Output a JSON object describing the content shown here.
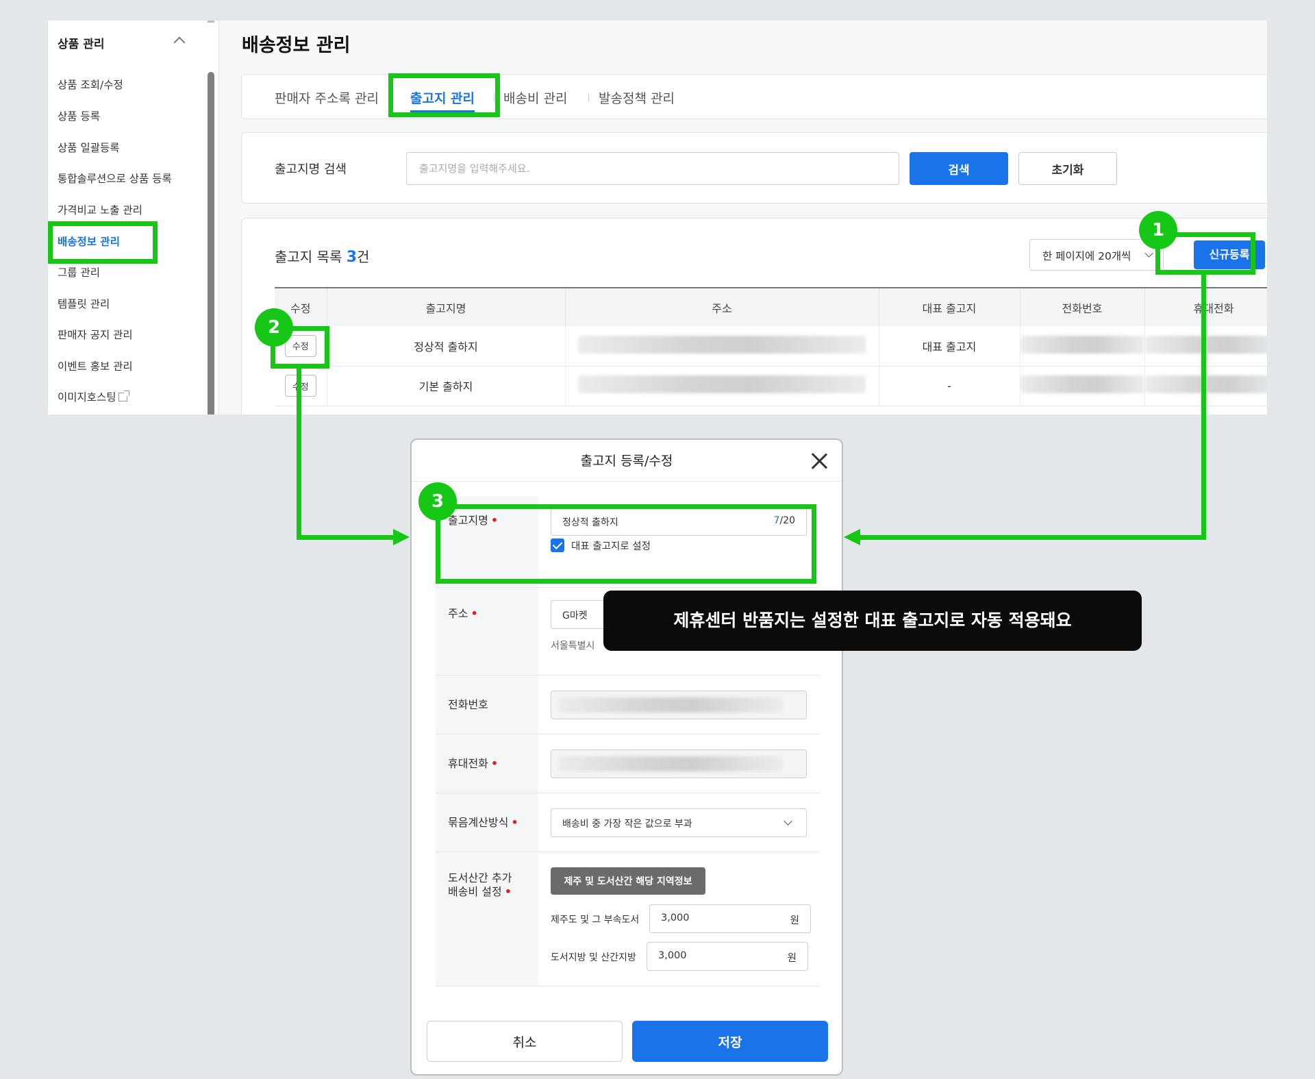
{
  "sidebar": {
    "section_title": "상품 관리",
    "items": [
      {
        "label": "상품 조회/수정"
      },
      {
        "label": "상품 등록"
      },
      {
        "label": "상품 일괄등록"
      },
      {
        "label": "통합솔루션으로 상품 등록"
      },
      {
        "label": "가격비교 노출 관리"
      },
      {
        "label": "배송정보 관리",
        "active": true
      },
      {
        "label": "그룹 관리"
      },
      {
        "label": "템플릿 관리"
      },
      {
        "label": "판매자 공지 관리"
      },
      {
        "label": "이벤트 홍보 관리"
      },
      {
        "label": "이미지호스팅"
      }
    ]
  },
  "page": {
    "title": "배송정보 관리"
  },
  "tabs": [
    {
      "label": "판매자 주소록 관리"
    },
    {
      "label": "출고지 관리",
      "active": true
    },
    {
      "label": "배송비 관리"
    },
    {
      "label": "발송정책 관리"
    }
  ],
  "search": {
    "label": "출고지명 검색",
    "placeholder": "출고지명을 입력해주세요.",
    "search_button": "검색",
    "reset_button": "초기화"
  },
  "list": {
    "title": "출고지 목록",
    "count": "3",
    "count_unit": "건",
    "page_size": "한 페이지에 20개씩",
    "new_button": "신규등록",
    "columns": [
      "수정",
      "출고지명",
      "주소",
      "대표 출고지",
      "전화번호",
      "휴대전화"
    ],
    "rows": [
      {
        "edit": "수정",
        "name": "정상적 출하지",
        "representative": "대표 출고지"
      },
      {
        "edit": "수정",
        "name": "기본 출하지",
        "representative": "-"
      }
    ]
  },
  "modal": {
    "title": "출고지 등록/수정",
    "fields": {
      "name": {
        "label": "출고지명",
        "value": "정상적 출하지",
        "count": "7",
        "max": "/20",
        "checkbox_label": "대표 출고지로 설정",
        "checked": true
      },
      "address": {
        "label": "주소",
        "value": "G마켓",
        "sub": "서울특별시"
      },
      "phone": {
        "label": "전화번호"
      },
      "mobile": {
        "label": "휴대전화"
      },
      "bundle": {
        "label": "묶음계산방식",
        "value": "배송비 중 가장 작은 값으로 부과"
      },
      "island": {
        "label_line1": "도서산간 추가",
        "label_line2": "배송비 설정",
        "region_button": "제주 및 도서산간 해당 지역정보",
        "jeju_label": "제주도 및 그 부속도서",
        "jeju_value": "3,000",
        "remote_label": "도서지방 및 산간지방",
        "remote_value": "3,000",
        "unit": "원"
      }
    },
    "cancel_button": "취소",
    "save_button": "저장"
  },
  "annotations": {
    "badge_1": "1",
    "badge_2": "2",
    "badge_3": "3",
    "tooltip": "제휴센터 반품지는 설정한 대표 출고지로 자동 적용돼요",
    "highlight_color": "#16c716"
  },
  "colors": {
    "accent": "#1a73e8",
    "required": "#e02020",
    "annotation": "#16c716"
  }
}
